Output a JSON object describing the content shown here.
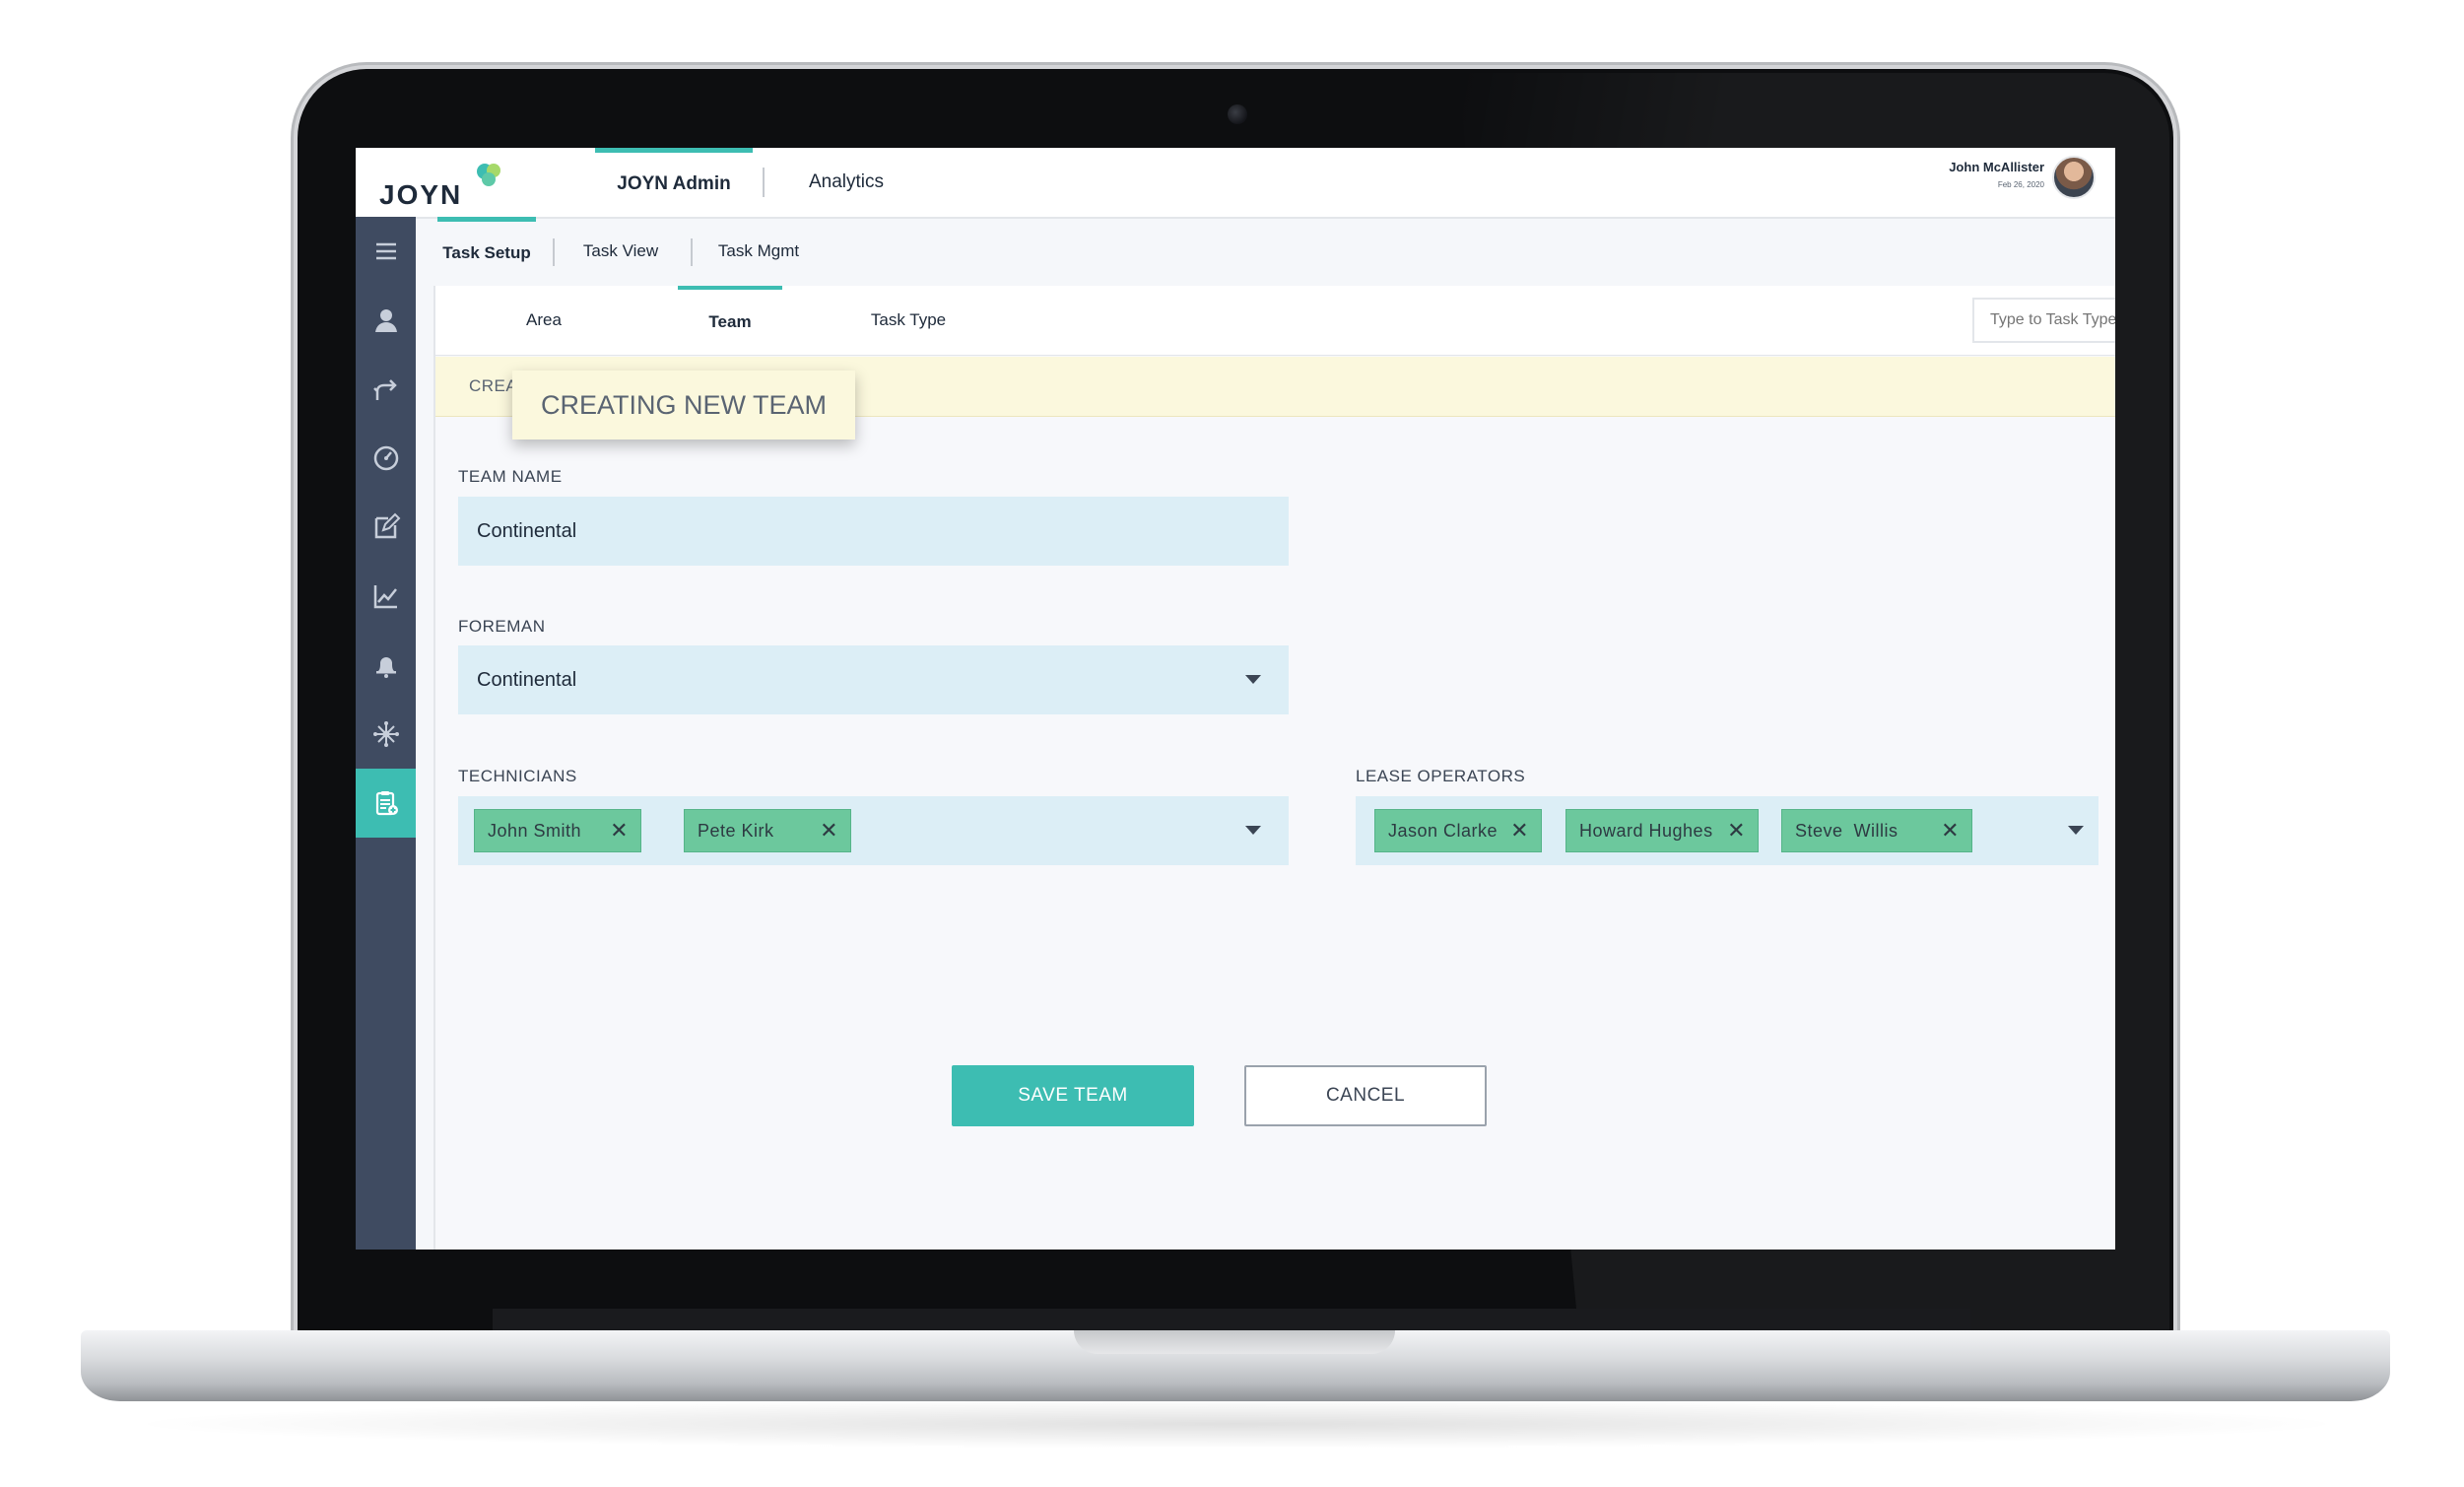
{
  "app": {
    "logo_text": "JOYN"
  },
  "topnav": {
    "tabs": [
      {
        "label": "JOYN Admin",
        "active": true
      },
      {
        "label": "Analytics",
        "active": false
      }
    ],
    "user": {
      "name": "John McAllister",
      "date": "Feb 26, 2020"
    }
  },
  "sidebar": {
    "items": [
      {
        "icon": "menu-icon"
      },
      {
        "icon": "user-icon"
      },
      {
        "icon": "route-icon"
      },
      {
        "icon": "gauge-icon"
      },
      {
        "icon": "edit-icon"
      },
      {
        "icon": "chart-icon"
      },
      {
        "icon": "bell-icon"
      },
      {
        "icon": "network-icon"
      },
      {
        "icon": "clipboard-icon",
        "active": true
      }
    ]
  },
  "subtabs": [
    {
      "label": "Task Setup",
      "active": true
    },
    {
      "label": "Task View",
      "active": false
    },
    {
      "label": "Task Mgmt",
      "active": false
    }
  ],
  "panel_tabs": [
    {
      "label": "Area",
      "active": false
    },
    {
      "label": "Team",
      "active": true
    },
    {
      "label": "Task Type",
      "active": false
    }
  ],
  "search": {
    "placeholder": "Type to Task Type"
  },
  "banner": {
    "text": "CREA",
    "tooltip": "CREATING NEW TEAM"
  },
  "form": {
    "team_name": {
      "label": "TEAM NAME",
      "value": "Continental"
    },
    "foreman": {
      "label": "FOREMAN",
      "value": "Continental"
    },
    "technicians": {
      "label": "TECHNICIANS",
      "chips": [
        "John Smith",
        "Pete Kirk"
      ]
    },
    "lease_operators": {
      "label": "LEASE OPERATORS",
      "chips": [
        "Jason Clarke",
        "Howard Hughes",
        "Steve  Willis"
      ]
    }
  },
  "actions": {
    "save_label": "SAVE TEAM",
    "cancel_label": "CANCEL"
  },
  "colors": {
    "accent": "#3dbdb2",
    "sidebar": "#3f4b61",
    "field_bg": "#dceef6",
    "chip_bg": "#6cc89d",
    "banner_bg": "#fbf8dd"
  }
}
